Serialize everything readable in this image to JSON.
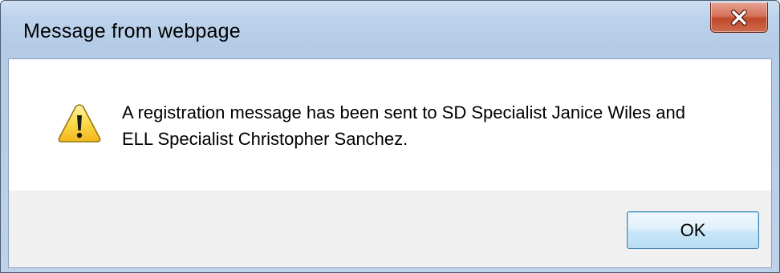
{
  "window": {
    "title": "Message from webpage"
  },
  "close_button": {
    "icon": "close-icon",
    "color": "#c7533a"
  },
  "message": {
    "icon": "warning-icon",
    "lines": [
      "A registration message has been sent to SD Specialist Janice Wiles and",
      "ELL Specialist Christopher Sanchez."
    ]
  },
  "buttons": {
    "ok_label": "OK"
  }
}
